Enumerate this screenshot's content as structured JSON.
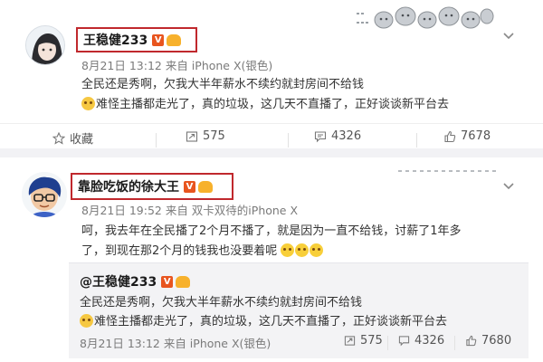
{
  "post1": {
    "username": "王稳健233",
    "verified_badge": "V",
    "meta": "8月21日 13:12 来自 iPhone X(银色)",
    "line1": "全民还是秀啊，欠我大半年薪水不续约就封房间不给钱",
    "line2": "难怪主播都走光了，真的垃圾，这几天不直播了，正好谈谈新平台去",
    "actions": {
      "favorite_label": "收藏",
      "repost_count": "575",
      "comment_count": "4326",
      "like_count": "7678"
    }
  },
  "post2": {
    "username": "靠脸吃饭的徐大王",
    "verified_badge": "V",
    "meta": "8月21日 19:52 来自 双卡双待的iPhone X",
    "line1": "呵，我去年在全民播了2个月不播了，就是因为一直不给钱，讨薪了1年多",
    "line2": "了，到现在那2个月的钱我也没要着呢",
    "repost": {
      "username": "@王稳健233",
      "verified_badge": "V",
      "line1": "全民还是秀啊，欠我大半年薪水不续约就封房间不给钱",
      "line2": "难怪主播都走光了，真的垃圾，这几天不直播了，正好谈谈新平台去",
      "meta": "8月21日 13:12 来自 iPhone X(银色)",
      "repost_count": "575",
      "comment_count": "4326",
      "like_count": "7680"
    }
  },
  "colors": {
    "highlight_box": "#c0282d",
    "verified_orange": "#e8551f",
    "level_badge": "#f7b12c",
    "meta_gray": "#7a7a7a"
  },
  "icons": [
    "more-chevron-icon",
    "favorite-star-icon",
    "repost-icon",
    "comment-icon",
    "like-thumb-icon",
    "emoji-sad-icon",
    "emoji-laugh-icon"
  ]
}
